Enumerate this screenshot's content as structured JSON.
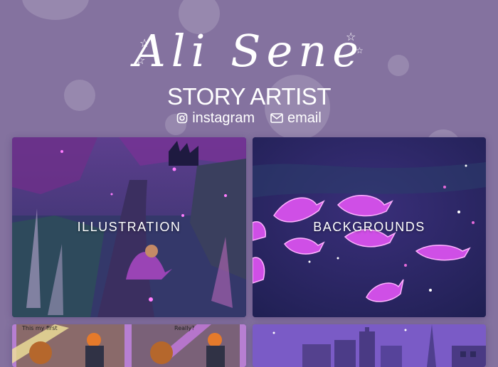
{
  "header": {
    "name": "Ali Sene",
    "subtitle": "STORY ARTIST",
    "links": [
      {
        "label": "instagram",
        "icon": "instagram-icon"
      },
      {
        "label": "email",
        "icon": "envelope-icon"
      }
    ]
  },
  "gallery": {
    "cards": [
      {
        "label": "ILLUSTRATION"
      },
      {
        "label": "BACKGROUNDS"
      },
      {
        "label": ""
      },
      {
        "label": ""
      }
    ],
    "comic_text": {
      "panel_left": "This my first",
      "panel_right": "Really?"
    }
  },
  "colors": {
    "background": "#84729f",
    "text": "#ffffff",
    "accent_glow": "#d66bff"
  }
}
